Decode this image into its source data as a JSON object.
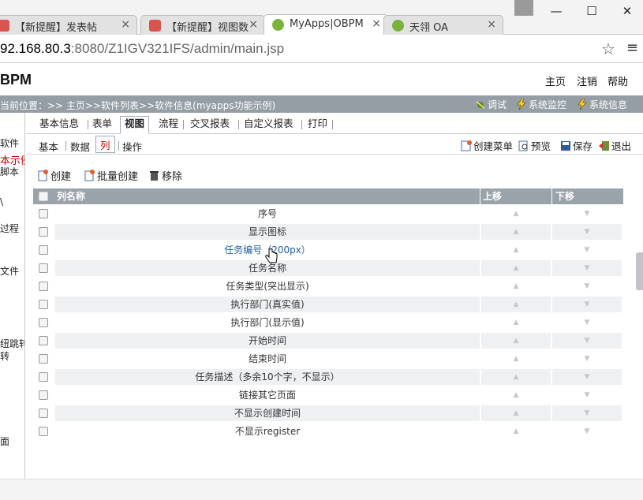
{
  "browser": {
    "tabs": [
      {
        "label": "【新提醒】发表帖",
        "active": false
      },
      {
        "label": "【新提醒】视图数",
        "active": false
      },
      {
        "label": "MyApps|OBPM",
        "active": true
      },
      {
        "label": "天翎 OA",
        "active": false
      }
    ],
    "tab_close": "×",
    "window_controls": {
      "minimize": "—",
      "maximize": "☐",
      "close": "✕"
    },
    "url_host": "92.168.80.3",
    "url_rest": ":8080/Z1IGV321IFS/admin/main.jsp",
    "star": "☆",
    "menu": "≡"
  },
  "app": {
    "logo": "BPM",
    "top_links": [
      "主页",
      "注销",
      "帮助"
    ],
    "location": "当前位置：>> 主页>>软件列表>>软件信息(myapps功能示例)",
    "location_buttons": [
      {
        "label": "调试",
        "icon": "bug-icon"
      },
      {
        "label": "系统监控",
        "icon": "lightning-icon"
      },
      {
        "label": "系统信息",
        "icon": "lightning-icon"
      }
    ]
  },
  "left_panel": {
    "items": [
      {
        "text": "软件",
        "color": "#222222"
      },
      {
        "text": "本示例",
        "color": "#cc0000"
      },
      {
        "text": "脚本",
        "color": "#222222"
      },
      {
        "text": "\\",
        "color": "#222222"
      },
      {
        "text": "过程",
        "color": "#222222"
      },
      {
        "text": "文件",
        "color": "#222222"
      },
      {
        "text": "纽跳转",
        "color": "#222222"
      },
      {
        "text": "转",
        "color": "#222222"
      },
      {
        "text": "面",
        "color": "#222222"
      }
    ]
  },
  "main_tabs": [
    "基本信息",
    "表单",
    "视图",
    "流程",
    "交叉报表",
    "自定义报表",
    "打印"
  ],
  "main_tab_active": "视图",
  "sub_tabs": [
    "基本",
    "数据",
    "列",
    "操作"
  ],
  "sub_tab_active": "列",
  "toolbar": [
    {
      "label": "创建菜单",
      "icon": "create-menu-icon"
    },
    {
      "label": "预览",
      "icon": "preview-icon"
    },
    {
      "label": "保存",
      "icon": "save-icon"
    },
    {
      "label": "退出",
      "icon": "exit-icon"
    }
  ],
  "actions": [
    {
      "label": "创建",
      "icon": "create-icon"
    },
    {
      "label": "批量创建",
      "icon": "batch-create-icon"
    },
    {
      "label": "移除",
      "icon": "trash-icon"
    }
  ],
  "table": {
    "headers": {
      "name": "列名称",
      "up": "上移",
      "down": "下移"
    },
    "up_glyph": "▲",
    "down_glyph": "▼",
    "rows": [
      "序号",
      "显示图标",
      "任务编号（200px）",
      "任务名称",
      "任务类型(突出显示)",
      "执行部门(真实值)",
      "执行部门(显示值)",
      "开始时间",
      "结束时间",
      "任务描述（多余10个字，不显示）",
      "链接其它页面",
      "不显示创建时间",
      "不显示register"
    ],
    "link_row_index": 2
  },
  "colors": {
    "location_bar": "#959ea5",
    "table_header": "#9aa3aa",
    "active_sub_tab": "#cc0000",
    "link": "#1f5ea8"
  }
}
